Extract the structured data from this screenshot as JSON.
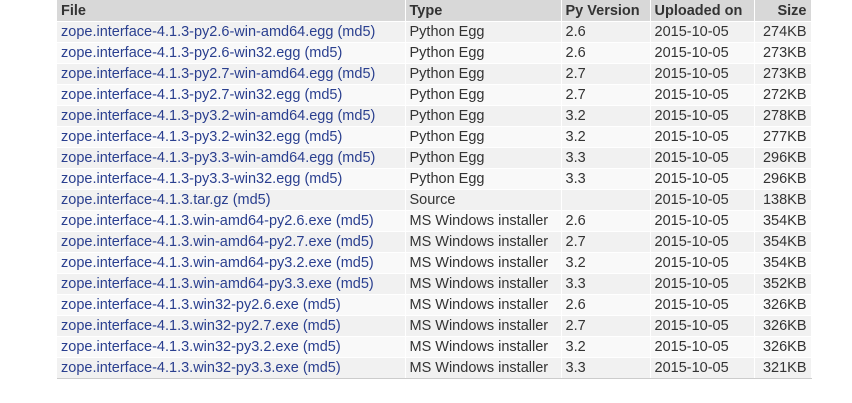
{
  "headers": {
    "file": "File",
    "type": "Type",
    "py_version": "Py Version",
    "uploaded_on": "Uploaded on",
    "size": "Size"
  },
  "md5_label": "(md5)",
  "rows": [
    {
      "file": "zope.interface-4.1.3-py2.6-win-amd64.egg",
      "type": "Python Egg",
      "py": "2.6",
      "uploaded": "2015-10-05",
      "size": "274KB"
    },
    {
      "file": "zope.interface-4.1.3-py2.6-win32.egg",
      "type": "Python Egg",
      "py": "2.6",
      "uploaded": "2015-10-05",
      "size": "273KB"
    },
    {
      "file": "zope.interface-4.1.3-py2.7-win-amd64.egg",
      "type": "Python Egg",
      "py": "2.7",
      "uploaded": "2015-10-05",
      "size": "273KB"
    },
    {
      "file": "zope.interface-4.1.3-py2.7-win32.egg",
      "type": "Python Egg",
      "py": "2.7",
      "uploaded": "2015-10-05",
      "size": "272KB"
    },
    {
      "file": "zope.interface-4.1.3-py3.2-win-amd64.egg",
      "type": "Python Egg",
      "py": "3.2",
      "uploaded": "2015-10-05",
      "size": "278KB"
    },
    {
      "file": "zope.interface-4.1.3-py3.2-win32.egg",
      "type": "Python Egg",
      "py": "3.2",
      "uploaded": "2015-10-05",
      "size": "277KB"
    },
    {
      "file": "zope.interface-4.1.3-py3.3-win-amd64.egg",
      "type": "Python Egg",
      "py": "3.3",
      "uploaded": "2015-10-05",
      "size": "296KB"
    },
    {
      "file": "zope.interface-4.1.3-py3.3-win32.egg",
      "type": "Python Egg",
      "py": "3.3",
      "uploaded": "2015-10-05",
      "size": "296KB"
    },
    {
      "file": "zope.interface-4.1.3.tar.gz",
      "type": "Source",
      "py": "",
      "uploaded": "2015-10-05",
      "size": "138KB"
    },
    {
      "file": "zope.interface-4.1.3.win-amd64-py2.6.exe",
      "type": "MS Windows installer",
      "py": "2.6",
      "uploaded": "2015-10-05",
      "size": "354KB"
    },
    {
      "file": "zope.interface-4.1.3.win-amd64-py2.7.exe",
      "type": "MS Windows installer",
      "py": "2.7",
      "uploaded": "2015-10-05",
      "size": "354KB"
    },
    {
      "file": "zope.interface-4.1.3.win-amd64-py3.2.exe",
      "type": "MS Windows installer",
      "py": "3.2",
      "uploaded": "2015-10-05",
      "size": "354KB"
    },
    {
      "file": "zope.interface-4.1.3.win-amd64-py3.3.exe",
      "type": "MS Windows installer",
      "py": "3.3",
      "uploaded": "2015-10-05",
      "size": "352KB"
    },
    {
      "file": "zope.interface-4.1.3.win32-py2.6.exe",
      "type": "MS Windows installer",
      "py": "2.6",
      "uploaded": "2015-10-05",
      "size": "326KB"
    },
    {
      "file": "zope.interface-4.1.3.win32-py2.7.exe",
      "type": "MS Windows installer",
      "py": "2.7",
      "uploaded": "2015-10-05",
      "size": "326KB"
    },
    {
      "file": "zope.interface-4.1.3.win32-py3.2.exe",
      "type": "MS Windows installer",
      "py": "3.2",
      "uploaded": "2015-10-05",
      "size": "326KB"
    },
    {
      "file": "zope.interface-4.1.3.win32-py3.3.exe",
      "type": "MS Windows installer",
      "py": "3.3",
      "uploaded": "2015-10-05",
      "size": "321KB"
    }
  ],
  "colors": {
    "header_bg": "#d8d8d8",
    "row_odd_bg": "#f1f1f1",
    "row_even_bg": "#f9f9f9",
    "link": "#2a3f8f",
    "text": "#333333"
  }
}
